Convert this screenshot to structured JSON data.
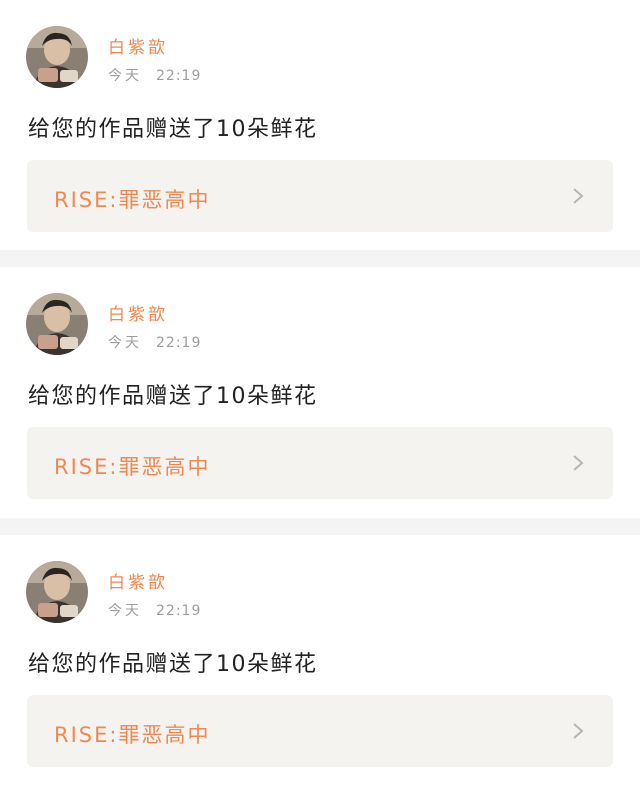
{
  "feed": {
    "items": [
      {
        "username": "白紫歆",
        "time_day": "今天",
        "time_clock": "22:19",
        "message": "给您的作品赠送了10朵鲜花",
        "work_title": "RISE:罪恶高中"
      },
      {
        "username": "白紫歆",
        "time_day": "今天",
        "time_clock": "22:19",
        "message": "给您的作品赠送了10朵鲜花",
        "work_title": "RISE:罪恶高中"
      },
      {
        "username": "白紫歆",
        "time_day": "今天",
        "time_clock": "22:19",
        "message": "给您的作品赠送了10朵鲜花",
        "work_title": "RISE:罪恶高中"
      }
    ]
  },
  "colors": {
    "accent": "#ed8a52",
    "muted_text": "#9e9e9e",
    "body_text": "#222222",
    "link_background": "#f4f3ef",
    "separator": "#f4f4f4"
  },
  "icons": {
    "avatar": "avatar-photo",
    "chevron": "chevron-right-icon"
  }
}
